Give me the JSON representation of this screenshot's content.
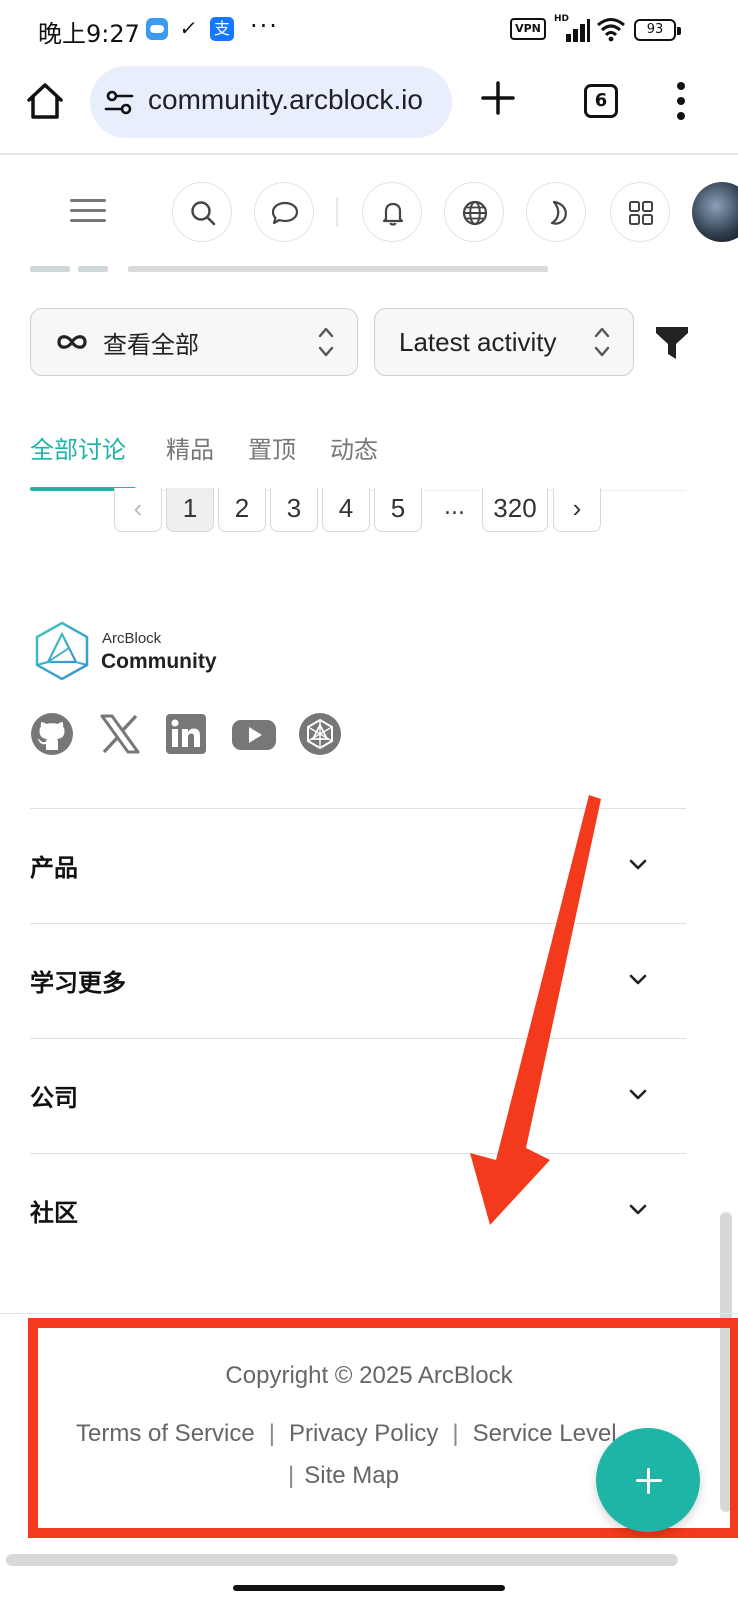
{
  "status_bar": {
    "time": "晚上9:27",
    "alipay_glyph": "支",
    "more": "···",
    "vpn": "VPN",
    "signal_label": "HD",
    "battery": "93"
  },
  "browser": {
    "url": "community.arcblock.io",
    "tab_count": "6"
  },
  "filters": {
    "scope_label": "查看全部",
    "sort_label": "Latest activity"
  },
  "tabs": [
    {
      "label": "全部讨论",
      "active": true
    },
    {
      "label": "精品",
      "active": false
    },
    {
      "label": "置顶",
      "active": false
    },
    {
      "label": "动态",
      "active": false
    }
  ],
  "pagination": {
    "pages": [
      "1",
      "2",
      "3",
      "4",
      "5"
    ],
    "current": "1",
    "ellipsis": "...",
    "last": "320"
  },
  "brand": {
    "small": "ArcBlock",
    "big": "Community",
    "accent_color": "#1fb5a6"
  },
  "socials": [
    "github-icon",
    "x-icon",
    "linkedin-icon",
    "youtube-icon",
    "arcblock-icon"
  ],
  "accordion": [
    {
      "label": "产品"
    },
    {
      "label": "学习更多"
    },
    {
      "label": "公司"
    },
    {
      "label": "社区"
    }
  ],
  "footer": {
    "copyright": "Copyright © 2025 ArcBlock",
    "links": [
      "Terms of Service",
      "Privacy Policy",
      "Service Level"
    ],
    "links_row2": [
      "Site Map"
    ],
    "sep": "|"
  },
  "annotation": {
    "color": "#f33a1c"
  }
}
